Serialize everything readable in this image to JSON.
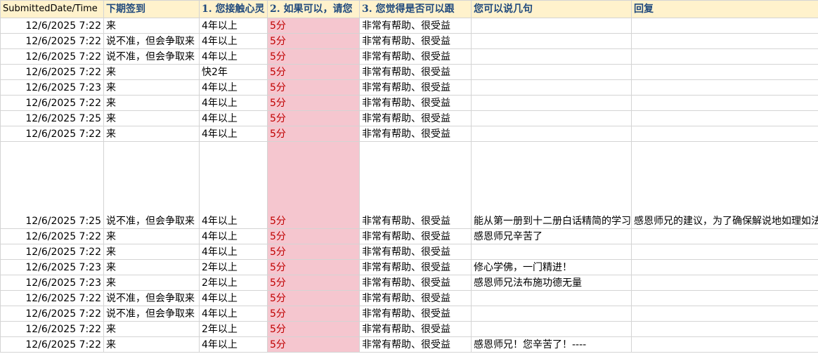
{
  "columns": [
    "SubmittedDate/Time",
    "下期签到",
    "1. 您接触心灵",
    "2. 如果可以，请您",
    "3. 您觉得是否可以跟",
    "您可以说几句",
    "回复"
  ],
  "rows": [
    {
      "date": "12/6/2025 7:22",
      "signin": "来",
      "duration": "4年以上",
      "rating": "5分",
      "help": "非常有帮助、很受益",
      "comment": "",
      "reply": ""
    },
    {
      "date": "12/6/2025 7:22",
      "signin": "说不准，但会争取来",
      "duration": "4年以上",
      "rating": "5分",
      "help": "非常有帮助、很受益",
      "comment": "",
      "reply": ""
    },
    {
      "date": "12/6/2025 7:22",
      "signin": "说不准，但会争取来",
      "duration": "4年以上",
      "rating": "5分",
      "help": "非常有帮助、很受益",
      "comment": "",
      "reply": ""
    },
    {
      "date": "12/6/2025 7:22",
      "signin": "来",
      "duration": "快2年",
      "rating": "5分",
      "help": "非常有帮助、很受益",
      "comment": "",
      "reply": ""
    },
    {
      "date": "12/6/2025 7:23",
      "signin": "来",
      "duration": "4年以上",
      "rating": "5分",
      "help": "非常有帮助、很受益",
      "comment": "",
      "reply": ""
    },
    {
      "date": "12/6/2025 7:22",
      "signin": "来",
      "duration": "4年以上",
      "rating": "5分",
      "help": "非常有帮助、很受益",
      "comment": "",
      "reply": ""
    },
    {
      "date": "12/6/2025 7:25",
      "signin": "来",
      "duration": "4年以上",
      "rating": "5分",
      "help": "非常有帮助、很受益",
      "comment": "",
      "reply": ""
    },
    {
      "date": "12/6/2025 7:22",
      "signin": "来",
      "duration": "4年以上",
      "rating": "5分",
      "help": "非常有帮助、很受益",
      "comment": "",
      "reply": ""
    },
    {
      "date": "12/6/2025 7:25",
      "signin": "说不准，但会争取来",
      "duration": "4年以上",
      "rating": "5分",
      "help": "非常有帮助、很受益",
      "comment": "能从第一册到十二册白话精简的学习吗？感恩师兄们慈悲法布施 随喜赞叹",
      "reply": "感恩师兄的建议，为了确保解说地如理如法，所以当时选择的是详细完整的学习路径，给师兄们做共修的同时也是对我自己的学习，唯有打好基础，才能避免解说出偏差。"
    },
    {
      "date": "12/6/2025 7:22",
      "signin": "来",
      "duration": "4年以上",
      "rating": "5分",
      "help": "非常有帮助、很受益",
      "comment": "感恩师兄辛苦了",
      "reply": ""
    },
    {
      "date": "12/6/2025 7:22",
      "signin": "来",
      "duration": "4年以上",
      "rating": "5分",
      "help": "非常有帮助、很受益",
      "comment": "",
      "reply": ""
    },
    {
      "date": "12/6/2025 7:23",
      "signin": "来",
      "duration": "2年以上",
      "rating": "5分",
      "help": "非常有帮助、很受益",
      "comment": "修心学佛，一门精进！",
      "reply": ""
    },
    {
      "date": "12/6/2025 7:23",
      "signin": "来",
      "duration": "2年以上",
      "rating": "5分",
      "help": "非常有帮助、很受益",
      "comment": "感恩师兄法布施功德无量",
      "reply": ""
    },
    {
      "date": "12/6/2025 7:22",
      "signin": "说不准，但会争取来",
      "duration": "4年以上",
      "rating": "5分",
      "help": "非常有帮助、很受益",
      "comment": "",
      "reply": ""
    },
    {
      "date": "12/6/2025 7:22",
      "signin": "说不准，但会争取来",
      "duration": "4年以上",
      "rating": "5分",
      "help": "非常有帮助、很受益",
      "comment": "",
      "reply": ""
    },
    {
      "date": "12/6/2025 7:22",
      "signin": "来",
      "duration": "2年以上",
      "rating": "5分",
      "help": "非常有帮助、很受益",
      "comment": "",
      "reply": ""
    },
    {
      "date": "12/6/2025 7:22",
      "signin": "来",
      "duration": "4年以上",
      "rating": "5分",
      "help": "非常有帮助、很受益",
      "comment": "感恩师兄！您辛苦了！----",
      "reply": ""
    }
  ],
  "colors": {
    "header_bg": "#fff2cc",
    "header_text": "#1f497d",
    "rating_bg": "#f5c6cf",
    "rating_text": "#c00000",
    "grid": "#d4d4d4"
  }
}
